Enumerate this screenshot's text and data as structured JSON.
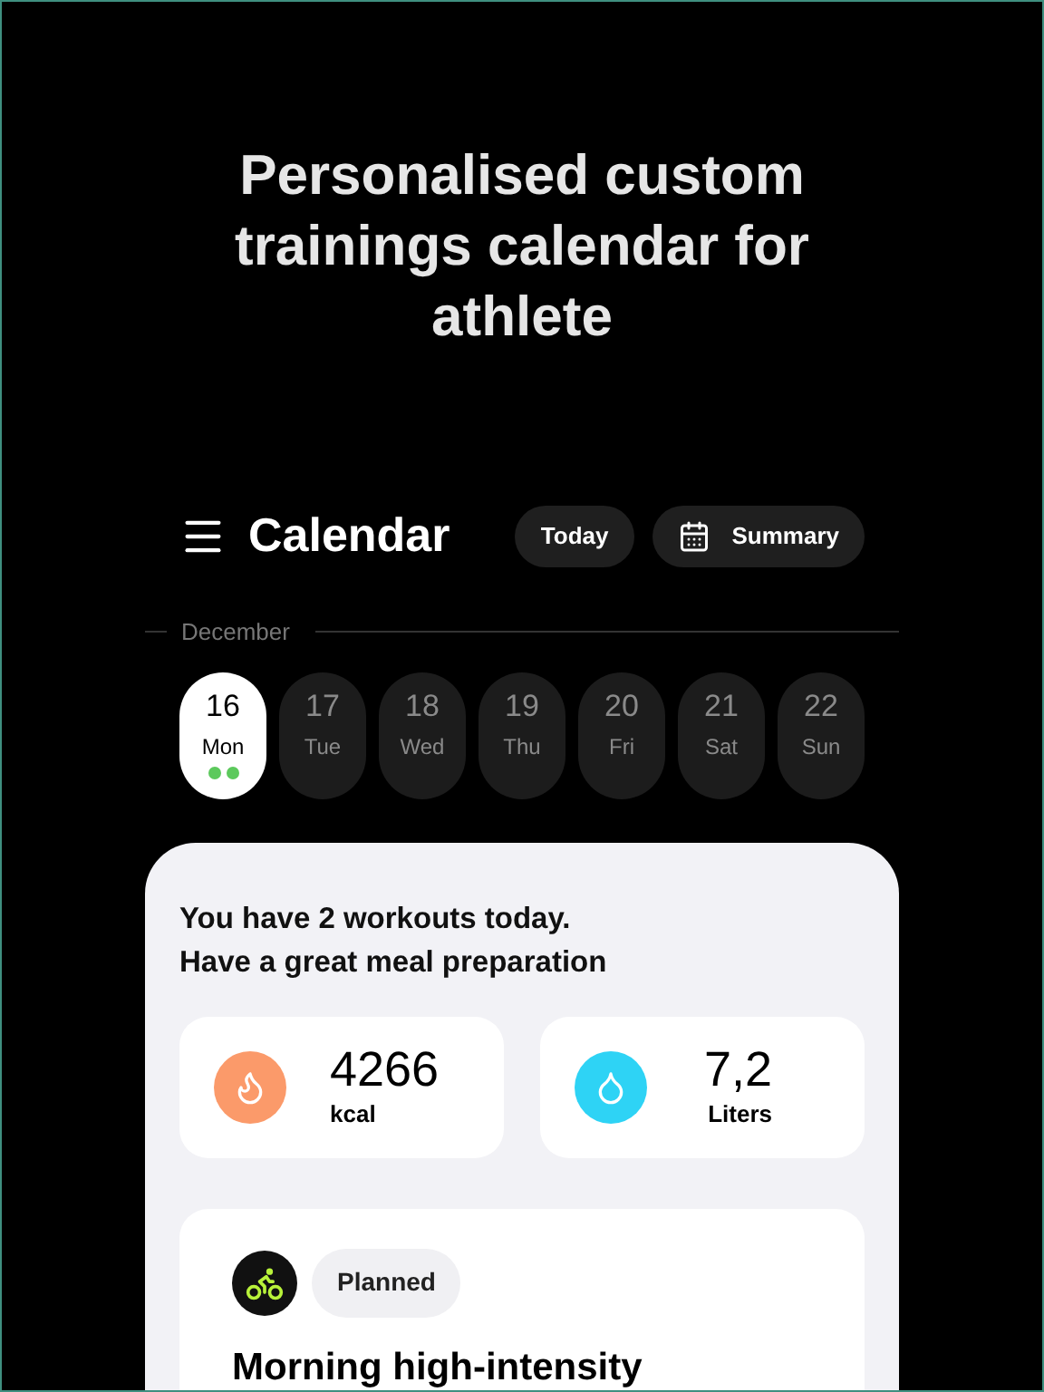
{
  "headline": "Personalised custom trainings calendar for athlete",
  "header": {
    "title": "Calendar",
    "buttons": [
      {
        "label": "Today",
        "kind": "plain"
      },
      {
        "label": "Summary",
        "kind": "calendar"
      }
    ]
  },
  "month": "December",
  "days": [
    {
      "date": "16",
      "weekday": "Mon",
      "selected": true,
      "markers": [
        {
          "kind": "workout"
        },
        {
          "kind": "workout"
        }
      ]
    },
    {
      "date": "17",
      "weekday": "Tue",
      "selected": false
    },
    {
      "date": "18",
      "weekday": "Wed",
      "selected": false
    },
    {
      "date": "19",
      "weekday": "Thu",
      "selected": false
    },
    {
      "date": "20",
      "weekday": "Fri",
      "selected": false
    },
    {
      "date": "21",
      "weekday": "Sat",
      "selected": false
    },
    {
      "date": "22",
      "weekday": "Sun",
      "selected": false
    }
  ],
  "summary": {
    "lines": [
      "You have 2 workouts today.",
      "Have a great meal preparation"
    ],
    "stats": [
      {
        "kind": "calories",
        "value": "4266",
        "unit": "kcal"
      },
      {
        "kind": "water",
        "value": "7,2",
        "unit": "Liters"
      }
    ]
  },
  "workout": {
    "kind": "cycling",
    "status": "Planned",
    "title": "Morning high-intensity"
  }
}
